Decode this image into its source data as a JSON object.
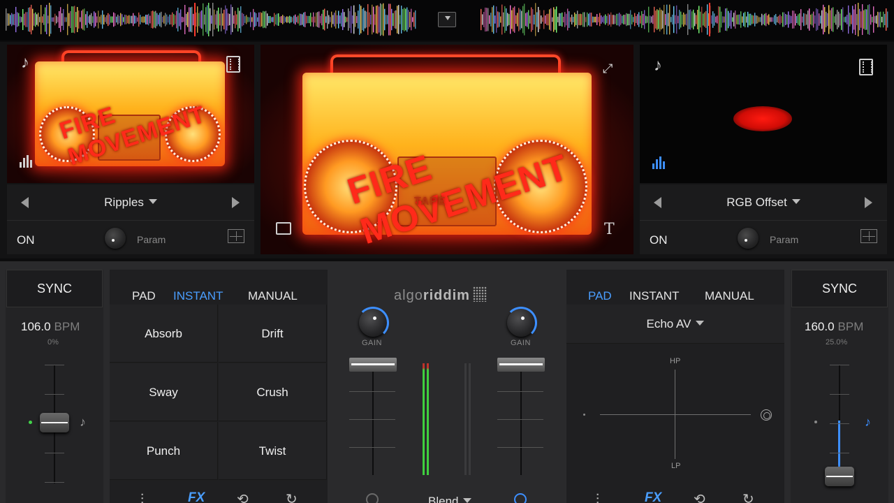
{
  "colors": {
    "accent_blue": "#4a9eff",
    "deck_bg": "#1f1f21",
    "vu_green": "#3fcf3f"
  },
  "left_deck": {
    "fx_name": "Ripples",
    "on_label": "ON",
    "param_label": "Param",
    "sync_label": "SYNC",
    "bpm_value": "106.0",
    "bpm_unit": "BPM",
    "pitch_percent": "0%",
    "pitch_level": 0.0,
    "pad_modes": [
      "PAD",
      "INSTANT",
      "MANUAL"
    ],
    "active_mode": "INSTANT",
    "pads": [
      "Absorb",
      "Drift",
      "Sway",
      "Crush",
      "Punch",
      "Twist"
    ],
    "icons": [
      "music-note-icon",
      "film-icon",
      "equalizer-icon",
      "grid-icon"
    ]
  },
  "right_deck": {
    "fx_name": "RGB Offset",
    "on_label": "ON",
    "param_label": "Param",
    "sync_label": "SYNC",
    "bpm_value": "160.0",
    "bpm_unit": "BPM",
    "pitch_percent": "25.0%",
    "pad_modes": [
      "PAD",
      "INSTANT",
      "MANUAL"
    ],
    "active_mode": "PAD",
    "audio_fx_name": "Echo AV",
    "xy_top_label": "HP",
    "xy_bottom_label": "LP"
  },
  "mixer": {
    "brand_prefix": "algo",
    "brand_suffix": "riddim",
    "gain_label_left": "GAIN",
    "gain_label_right": "GAIN",
    "crossfader_mode": "Blend"
  },
  "main_preview": {
    "boombox_text": "FIRE MOVEMENT",
    "deck_text": "TAPE"
  }
}
